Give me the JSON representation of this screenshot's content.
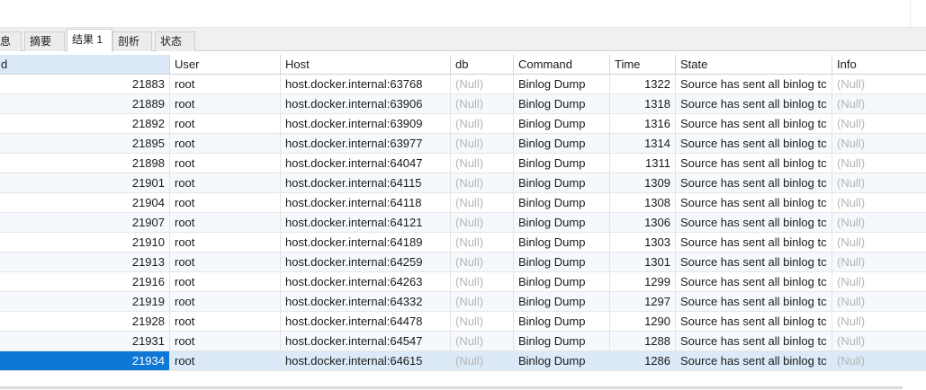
{
  "tabs": [
    {
      "label": "息",
      "active": false
    },
    {
      "label": "摘要",
      "active": false
    },
    {
      "label": "结果 1",
      "active": true
    },
    {
      "label": "剖析",
      "active": false
    },
    {
      "label": "状态",
      "active": false
    }
  ],
  "grid": {
    "columns": [
      "d",
      "User",
      "Host",
      "db",
      "Command",
      "Time",
      "State",
      "Info"
    ],
    "selected_row": 14,
    "rows": [
      {
        "id": "21883",
        "user": "root",
        "host": "host.docker.internal:63768",
        "db": "(Null)",
        "command": "Binlog Dump",
        "time": "1322",
        "state": "Source has sent all binlog tc",
        "info": "(Null)"
      },
      {
        "id": "21889",
        "user": "root",
        "host": "host.docker.internal:63906",
        "db": "(Null)",
        "command": "Binlog Dump",
        "time": "1318",
        "state": "Source has sent all binlog tc",
        "info": "(Null)"
      },
      {
        "id": "21892",
        "user": "root",
        "host": "host.docker.internal:63909",
        "db": "(Null)",
        "command": "Binlog Dump",
        "time": "1316",
        "state": "Source has sent all binlog tc",
        "info": "(Null)"
      },
      {
        "id": "21895",
        "user": "root",
        "host": "host.docker.internal:63977",
        "db": "(Null)",
        "command": "Binlog Dump",
        "time": "1314",
        "state": "Source has sent all binlog tc",
        "info": "(Null)"
      },
      {
        "id": "21898",
        "user": "root",
        "host": "host.docker.internal:64047",
        "db": "(Null)",
        "command": "Binlog Dump",
        "time": "1311",
        "state": "Source has sent all binlog tc",
        "info": "(Null)"
      },
      {
        "id": "21901",
        "user": "root",
        "host": "host.docker.internal:64115",
        "db": "(Null)",
        "command": "Binlog Dump",
        "time": "1309",
        "state": "Source has sent all binlog tc",
        "info": "(Null)"
      },
      {
        "id": "21904",
        "user": "root",
        "host": "host.docker.internal:64118",
        "db": "(Null)",
        "command": "Binlog Dump",
        "time": "1308",
        "state": "Source has sent all binlog tc",
        "info": "(Null)"
      },
      {
        "id": "21907",
        "user": "root",
        "host": "host.docker.internal:64121",
        "db": "(Null)",
        "command": "Binlog Dump",
        "time": "1306",
        "state": "Source has sent all binlog tc",
        "info": "(Null)"
      },
      {
        "id": "21910",
        "user": "root",
        "host": "host.docker.internal:64189",
        "db": "(Null)",
        "command": "Binlog Dump",
        "time": "1303",
        "state": "Source has sent all binlog tc",
        "info": "(Null)"
      },
      {
        "id": "21913",
        "user": "root",
        "host": "host.docker.internal:64259",
        "db": "(Null)",
        "command": "Binlog Dump",
        "time": "1301",
        "state": "Source has sent all binlog tc",
        "info": "(Null)"
      },
      {
        "id": "21916",
        "user": "root",
        "host": "host.docker.internal:64263",
        "db": "(Null)",
        "command": "Binlog Dump",
        "time": "1299",
        "state": "Source has sent all binlog tc",
        "info": "(Null)"
      },
      {
        "id": "21919",
        "user": "root",
        "host": "host.docker.internal:64332",
        "db": "(Null)",
        "command": "Binlog Dump",
        "time": "1297",
        "state": "Source has sent all binlog tc",
        "info": "(Null)"
      },
      {
        "id": "21928",
        "user": "root",
        "host": "host.docker.internal:64478",
        "db": "(Null)",
        "command": "Binlog Dump",
        "time": "1290",
        "state": "Source has sent all binlog tc",
        "info": "(Null)"
      },
      {
        "id": "21931",
        "user": "root",
        "host": "host.docker.internal:64547",
        "db": "(Null)",
        "command": "Binlog Dump",
        "time": "1288",
        "state": "Source has sent all binlog tc",
        "info": "(Null)"
      },
      {
        "id": "21934",
        "user": "root",
        "host": "host.docker.internal:64615",
        "db": "(Null)",
        "command": "Binlog Dump",
        "time": "1286",
        "state": "Source has sent all binlog tc",
        "info": "(Null)"
      }
    ]
  }
}
